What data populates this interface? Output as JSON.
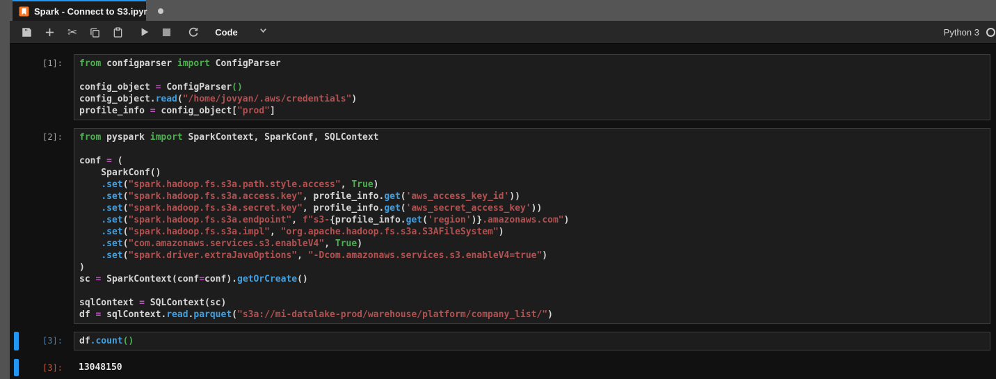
{
  "window": {
    "tab": {
      "title": "Spark - Connect to S3.ipyr",
      "dirty": true,
      "icon": "notebook-icon"
    }
  },
  "toolbar": {
    "buttons": [
      {
        "name": "save",
        "icon": "save-icon"
      },
      {
        "name": "insert-cell",
        "icon": "plus-icon"
      },
      {
        "name": "cut-cells",
        "icon": "scissors-icon"
      },
      {
        "name": "copy-cells",
        "icon": "copy-icon"
      },
      {
        "name": "paste-cells",
        "icon": "paste-icon"
      },
      {
        "name": "run-cell",
        "icon": "play-icon"
      },
      {
        "name": "interrupt-kernel",
        "icon": "stop-icon"
      },
      {
        "name": "restart-kernel",
        "icon": "restart-icon"
      }
    ],
    "cell_type": "Code",
    "kernel": "Python 3",
    "kernel_status_icon": "kernel-idle-circle"
  },
  "colors": {
    "accent_blue": "#2196f3",
    "tab_top_border": "#2196f3",
    "tabbar_gray": "#555555",
    "toolbar_bg": "#282828",
    "notebook_bg": "#111111",
    "cell_bg": "#1d1d1d",
    "cell_border": "#3f3f3f",
    "keyword_green": "#4caf50",
    "string_red": "#b35151",
    "operator_magenta": "#c24fc2",
    "method_blue": "#42a0e0",
    "prompt_gray": "#a8a8a8",
    "prompt_active_blue": "#4e81ab",
    "output_prompt_orange": "#bf5b3f",
    "notebook_icon_orange": "#f37726"
  },
  "notebook": {
    "cells": [
      {
        "prompt": "[1]:",
        "active": false,
        "lines": [
          [
            [
              "k",
              "from"
            ],
            [
              "t",
              " configparser "
            ],
            [
              "k",
              "import"
            ],
            [
              "t",
              " ConfigParser"
            ]
          ],
          [],
          [
            [
              "t",
              "config_object "
            ],
            [
              "op",
              "="
            ],
            [
              "t",
              " ConfigParser"
            ],
            [
              "g",
              "()"
            ]
          ],
          [
            [
              "t",
              "config_object."
            ],
            [
              "fn",
              "read"
            ],
            [
              "t",
              "("
            ],
            [
              "s",
              "\"/home/jovyan/.aws/credentials\""
            ],
            [
              "t",
              ")"
            ]
          ],
          [
            [
              "t",
              "profile_info "
            ],
            [
              "op",
              "="
            ],
            [
              "t",
              " config_object["
            ],
            [
              "s",
              "\"prod\""
            ],
            [
              "t",
              "]"
            ]
          ]
        ]
      },
      {
        "prompt": "[2]:",
        "active": false,
        "lines": [
          [
            [
              "k",
              "from"
            ],
            [
              "t",
              " pyspark "
            ],
            [
              "k",
              "import"
            ],
            [
              "t",
              " SparkContext, SparkConf, SQLContext"
            ]
          ],
          [],
          [
            [
              "t",
              "conf "
            ],
            [
              "op",
              "="
            ],
            [
              "t",
              " ("
            ]
          ],
          [
            [
              "t",
              "    SparkConf()"
            ]
          ],
          [
            [
              "t",
              "    "
            ],
            [
              "fn",
              ".set"
            ],
            [
              "t",
              "("
            ],
            [
              "s",
              "\"spark.hadoop.fs.s3a.path.style.access\""
            ],
            [
              "t",
              ", "
            ],
            [
              "b",
              "True"
            ],
            [
              "t",
              ")"
            ]
          ],
          [
            [
              "t",
              "    "
            ],
            [
              "fn",
              ".set"
            ],
            [
              "t",
              "("
            ],
            [
              "s",
              "\"spark.hadoop.fs.s3a.access.key\""
            ],
            [
              "t",
              ", profile_info."
            ],
            [
              "fn",
              "get"
            ],
            [
              "t",
              "("
            ],
            [
              "s",
              "'aws_access_key_id'"
            ],
            [
              "t",
              "))"
            ]
          ],
          [
            [
              "t",
              "    "
            ],
            [
              "fn",
              ".set"
            ],
            [
              "t",
              "("
            ],
            [
              "s",
              "\"spark.hadoop.fs.s3a.secret.key\""
            ],
            [
              "t",
              ", profile_info."
            ],
            [
              "fn",
              "get"
            ],
            [
              "t",
              "("
            ],
            [
              "s",
              "'aws_secret_access_key'"
            ],
            [
              "t",
              "))"
            ]
          ],
          [
            [
              "t",
              "    "
            ],
            [
              "fn",
              ".set"
            ],
            [
              "t",
              "("
            ],
            [
              "s",
              "\"spark.hadoop.fs.s3a.endpoint\""
            ],
            [
              "t",
              ", "
            ],
            [
              "s",
              "f\"s3-"
            ],
            [
              "t",
              "{profile_info."
            ],
            [
              "fn",
              "get"
            ],
            [
              "t",
              "("
            ],
            [
              "s",
              "'region'"
            ],
            [
              "t",
              ")}"
            ],
            [
              "s",
              ".amazonaws.com\""
            ],
            [
              "t",
              ")"
            ]
          ],
          [
            [
              "t",
              "    "
            ],
            [
              "fn",
              ".set"
            ],
            [
              "t",
              "("
            ],
            [
              "s",
              "\"spark.hadoop.fs.s3a.impl\""
            ],
            [
              "t",
              ", "
            ],
            [
              "s",
              "\"org.apache.hadoop.fs.s3a.S3AFileSystem\""
            ],
            [
              "t",
              ")"
            ]
          ],
          [
            [
              "t",
              "    "
            ],
            [
              "fn",
              ".set"
            ],
            [
              "t",
              "("
            ],
            [
              "s",
              "\"com.amazonaws.services.s3.enableV4\""
            ],
            [
              "t",
              ", "
            ],
            [
              "b",
              "True"
            ],
            [
              "t",
              ")"
            ]
          ],
          [
            [
              "t",
              "    "
            ],
            [
              "fn",
              ".set"
            ],
            [
              "t",
              "("
            ],
            [
              "s",
              "\"spark.driver.extraJavaOptions\""
            ],
            [
              "t",
              ", "
            ],
            [
              "s",
              "\"-Dcom.amazonaws.services.s3.enableV4=true\""
            ],
            [
              "t",
              ")"
            ]
          ],
          [
            [
              "t",
              ")"
            ]
          ],
          [
            [
              "t",
              "sc "
            ],
            [
              "op",
              "="
            ],
            [
              "t",
              " SparkContext(conf"
            ],
            [
              "op",
              "="
            ],
            [
              "t",
              "conf)."
            ],
            [
              "fn",
              "getOrCreate"
            ],
            [
              "t",
              "()"
            ]
          ],
          [],
          [
            [
              "t",
              "sqlContext "
            ],
            [
              "op",
              "="
            ],
            [
              "t",
              " SQLContext(sc)"
            ]
          ],
          [
            [
              "t",
              "df "
            ],
            [
              "op",
              "="
            ],
            [
              "t",
              " sqlContext."
            ],
            [
              "fn",
              "read"
            ],
            [
              "t",
              "."
            ],
            [
              "fn",
              "parquet"
            ],
            [
              "t",
              "("
            ],
            [
              "s",
              "\"s3a://mi-datalake-prod/warehouse/platform/company_list/\""
            ],
            [
              "t",
              ")"
            ]
          ]
        ]
      },
      {
        "prompt": "[3]:",
        "active": true,
        "lines": [
          [
            [
              "t",
              "df"
            ],
            [
              "fn",
              ".count"
            ],
            [
              "g",
              "()"
            ]
          ]
        ]
      }
    ],
    "output": {
      "prompt": "[3]:",
      "value": "13048150",
      "active": true
    }
  }
}
